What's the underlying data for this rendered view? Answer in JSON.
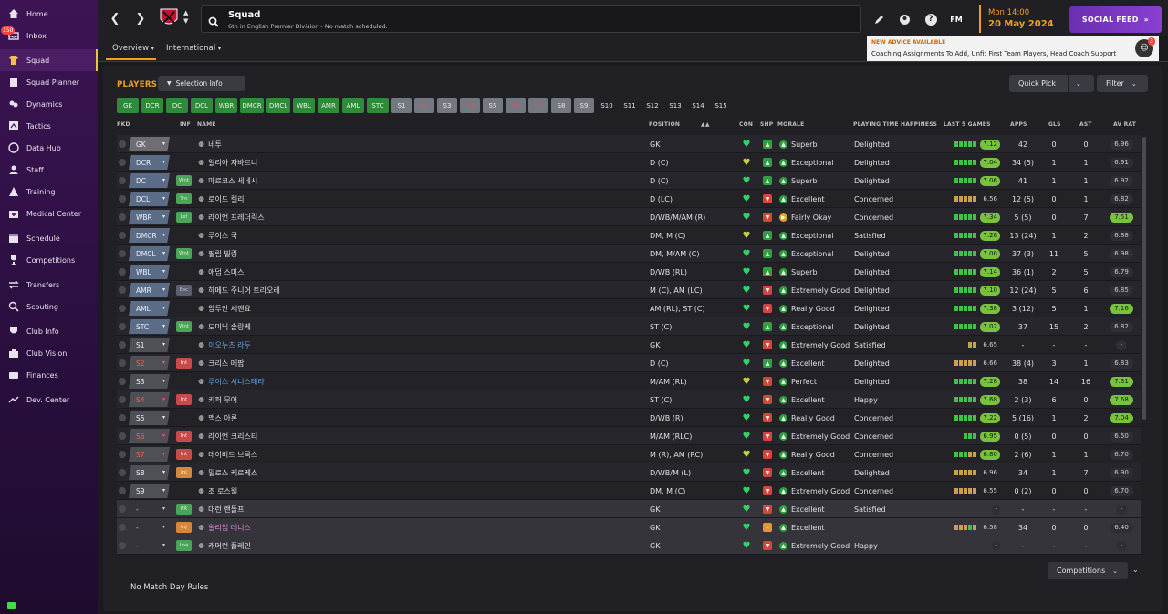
{
  "sidebar": {
    "inbox_badge": "150",
    "items": [
      {
        "label": "Home",
        "icon": "home-icon"
      },
      {
        "label": "Inbox",
        "icon": "inbox-icon"
      },
      {
        "label": "Squad",
        "icon": "shirt-icon"
      },
      {
        "label": "Squad Planner",
        "icon": "planner-icon"
      },
      {
        "label": "Dynamics",
        "icon": "dynamics-icon"
      },
      {
        "label": "Tactics",
        "icon": "tactics-icon"
      },
      {
        "label": "Data Hub",
        "icon": "data-hub-icon"
      },
      {
        "label": "Staff",
        "icon": "staff-icon"
      },
      {
        "label": "Training",
        "icon": "training-icon"
      },
      {
        "label": "Medical Center",
        "icon": "medical-icon"
      },
      {
        "label": "Schedule",
        "icon": "calendar-icon"
      },
      {
        "label": "Competitions",
        "icon": "trophy-icon"
      },
      {
        "label": "Transfers",
        "icon": "transfer-icon"
      },
      {
        "label": "Scouting",
        "icon": "scouting-icon"
      },
      {
        "label": "Club Info",
        "icon": "shield-icon"
      },
      {
        "label": "Club Vision",
        "icon": "vision-icon"
      },
      {
        "label": "Finances",
        "icon": "finances-icon"
      },
      {
        "label": "Dev. Center",
        "icon": "dev-center-icon"
      }
    ]
  },
  "header": {
    "title": "Squad",
    "subtitle": "6th in English Premier Division - No match scheduled.",
    "fm_label": "FM",
    "date_time": "Mon 14:00",
    "date_day": "20 May 2024",
    "social_feed": "SOCIAL FEED"
  },
  "subtabs": {
    "overview": "Overview",
    "international": "International"
  },
  "advice": {
    "heading": "NEW ADVICE AVAILABLE",
    "text": "Coaching Assignments To Add, Unfit First Team Players, Head Coach Support",
    "count": "3"
  },
  "players_heading": "PLAYERS",
  "selection_info": "Selection Info",
  "quick_pick": "Quick Pick",
  "filter": "Filter",
  "position_tabs": [
    "GK",
    "DCR",
    "DC",
    "DCL",
    "WBR",
    "DMCR",
    "DMCL",
    "WBL",
    "AMR",
    "AML",
    "STC",
    "S1",
    "S2",
    "S3",
    "S4",
    "S5",
    "S6",
    "S7",
    "S8",
    "S9",
    "S10",
    "S11",
    "S12",
    "S13",
    "S14",
    "S15"
  ],
  "columns": {
    "pkd": "PKD",
    "inf": "INF",
    "name": "NAME",
    "position": "POSITION",
    "con": "CON",
    "shp": "SHP",
    "morale": "MORALE",
    "pth": "PLAYING TIME HAPPINESS",
    "form": "LAST 5 GAMES",
    "apps": "APPS",
    "gls": "GLS",
    "ast": "AST",
    "avr": "AV RAT"
  },
  "players": [
    {
      "role": "GK",
      "inf": "",
      "name": "네투",
      "position": "GK",
      "shp": "up",
      "morale": "Superb",
      "pth": "Delighted",
      "form": "7.12",
      "apps": "42",
      "gls": "0",
      "ast": "0",
      "avr": "6.96"
    },
    {
      "role": "DCR",
      "inf": "",
      "name": "일리아 자바르니",
      "position": "D (C)",
      "shp": "up",
      "morale": "Exceptional",
      "pth": "Delighted",
      "form": "7.04",
      "apps": "34 (5)",
      "gls": "1",
      "ast": "1",
      "avr": "6.91"
    },
    {
      "role": "DC",
      "inf": "Wnt",
      "name": "마르코스 세네시",
      "position": "D (C)",
      "shp": "up",
      "morale": "Superb",
      "pth": "Delighted",
      "form": "7.06",
      "apps": "41",
      "gls": "1",
      "ast": "1",
      "avr": "6.92"
    },
    {
      "role": "DCL",
      "inf": "Trn",
      "name": "로이드 켈리",
      "position": "D (LC)",
      "shp": "down",
      "morale": "Excellent",
      "pth": "Concerned",
      "form": "6.56",
      "apps": "12 (5)",
      "gls": "0",
      "ast": "1",
      "avr": "6.82"
    },
    {
      "role": "WBR",
      "inf": "Lst",
      "name": "라이언 프레더릭스",
      "position": "D/WB/M/AM (R)",
      "shp": "down",
      "morale": "Fairly Okay",
      "pth": "Concerned",
      "form": "7.34",
      "apps": "5 (5)",
      "gls": "0",
      "ast": "7",
      "avr": "7.51"
    },
    {
      "role": "DMCR",
      "inf": "",
      "name": "루이스 쿡",
      "position": "DM, M (C)",
      "shp": "up",
      "morale": "Exceptional",
      "pth": "Satisfied",
      "form": "7.26",
      "apps": "13 (24)",
      "gls": "1",
      "ast": "2",
      "avr": "6.88"
    },
    {
      "role": "DMCL",
      "inf": "Wnt",
      "name": "필립 빌링",
      "position": "DM, M/AM (C)",
      "shp": "up",
      "morale": "Exceptional",
      "pth": "Delighted",
      "form": "7.00",
      "apps": "37 (3)",
      "gls": "11",
      "ast": "5",
      "avr": "6.98"
    },
    {
      "role": "WBL",
      "inf": "",
      "name": "애덤 스미스",
      "position": "D/WB (RL)",
      "shp": "up",
      "morale": "Superb",
      "pth": "Delighted",
      "form": "7.14",
      "apps": "36 (1)",
      "gls": "2",
      "ast": "5",
      "avr": "6.79"
    },
    {
      "role": "AMR",
      "inf": "Esc",
      "name": "하메드 주니어 트라오레",
      "position": "M (C), AM (LC)",
      "shp": "down",
      "morale": "Extremely Good",
      "pth": "Delighted",
      "form": "7.10",
      "apps": "12 (24)",
      "gls": "5",
      "ast": "6",
      "avr": "6.85"
    },
    {
      "role": "AML",
      "inf": "",
      "name": "앙투안 세멘요",
      "position": "AM (RL), ST (C)",
      "shp": "down",
      "morale": "Really Good",
      "pth": "Delighted",
      "form": "7.38",
      "apps": "3 (12)",
      "gls": "5",
      "ast": "1",
      "avr": "7.16"
    },
    {
      "role": "STC",
      "inf": "Wnt",
      "name": "도미닉 솔랑케",
      "position": "ST (C)",
      "shp": "up",
      "morale": "Exceptional",
      "pth": "Delighted",
      "form": "7.02",
      "apps": "37",
      "gls": "15",
      "ast": "2",
      "avr": "6.82"
    },
    {
      "role": "S1",
      "inf": "",
      "name": "이오누츠 라두",
      "position": "GK",
      "shp": "down",
      "morale": "Extremely Good",
      "pth": "Satisfied",
      "form": "6.65",
      "apps": "-",
      "gls": "-",
      "ast": "-",
      "avr": "-"
    },
    {
      "role": "S2",
      "inf": "Int",
      "name": "크리스 메팜",
      "position": "D (C)",
      "shp": "up",
      "morale": "Excellent",
      "pth": "Delighted",
      "form": "6.66",
      "apps": "38 (4)",
      "gls": "3",
      "ast": "1",
      "avr": "6.83"
    },
    {
      "role": "S3",
      "inf": "",
      "name": "루이스 시니스테라",
      "position": "M/AM (RL)",
      "shp": "down",
      "morale": "Perfect",
      "pth": "Delighted",
      "form": "7.28",
      "apps": "38",
      "gls": "14",
      "ast": "16",
      "avr": "7.31"
    },
    {
      "role": "S4",
      "inf": "Int",
      "name": "키퍼 무어",
      "position": "ST (C)",
      "shp": "down",
      "morale": "Excellent",
      "pth": "Happy",
      "form": "7.68",
      "apps": "2 (3)",
      "gls": "6",
      "ast": "0",
      "avr": "7.68"
    },
    {
      "role": "S5",
      "inf": "",
      "name": "맥스 아론",
      "position": "D/WB (R)",
      "shp": "down",
      "morale": "Really Good",
      "pth": "Concerned",
      "form": "7.22",
      "apps": "5 (16)",
      "gls": "1",
      "ast": "2",
      "avr": "7.04"
    },
    {
      "role": "S6",
      "inf": "Int",
      "name": "라이언 크리스티",
      "position": "M/AM (RLC)",
      "shp": "down",
      "morale": "Extremely Good",
      "pth": "Concerned",
      "form": "6.95",
      "apps": "0 (5)",
      "gls": "0",
      "ast": "0",
      "avr": "6.50"
    },
    {
      "role": "S7",
      "inf": "Int",
      "name": "데이비드 브룩스",
      "position": "M (R), AM (RC)",
      "shp": "down",
      "morale": "Really Good",
      "pth": "Concerned",
      "form": "6.80",
      "apps": "2 (6)",
      "gls": "1",
      "ast": "1",
      "avr": "6.70"
    },
    {
      "role": "S8",
      "inf": "Inj",
      "name": "밀로스 케르케스",
      "position": "D/WB/M (L)",
      "shp": "down",
      "morale": "Excellent",
      "pth": "Delighted",
      "form": "6.96",
      "apps": "34",
      "gls": "1",
      "ast": "7",
      "avr": "6.90"
    },
    {
      "role": "S9",
      "inf": "",
      "name": "조 로스웰",
      "position": "DM, M (C)",
      "shp": "down",
      "morale": "Extremely Good",
      "pth": "Concerned",
      "form": "6.55",
      "apps": "0 (2)",
      "gls": "0",
      "ast": "0",
      "avr": "6.70"
    },
    {
      "role": "-",
      "inf": "PR",
      "name": "대런 랜돌프",
      "position": "GK",
      "shp": "down",
      "morale": "Excellent",
      "pth": "Satisfied",
      "form": "-",
      "apps": "-",
      "gls": "-",
      "ast": "-",
      "avr": "-"
    },
    {
      "role": "-",
      "inf": "Inj",
      "name": "윌리엄 데니스",
      "position": "GK",
      "shp": "mid",
      "morale": "Excellent",
      "pth": "",
      "form": "6.58",
      "apps": "34",
      "gls": "0",
      "ast": "0",
      "avr": "6.40"
    },
    {
      "role": "-",
      "inf": "Loa",
      "name": "캐머런 플레인",
      "position": "GK",
      "shp": "down",
      "morale": "Extremely Good",
      "pth": "Happy",
      "form": "-",
      "apps": "-",
      "gls": "-",
      "ast": "-",
      "avr": "-"
    }
  ],
  "competitions": "Competitions",
  "match_day_rules": "No Match Day Rules",
  "colors": {
    "accent": "#f0a020",
    "sidebar": "#3d1354",
    "social": "#7a38c0",
    "good": "#3fc24a",
    "bad": "#d2463c"
  }
}
